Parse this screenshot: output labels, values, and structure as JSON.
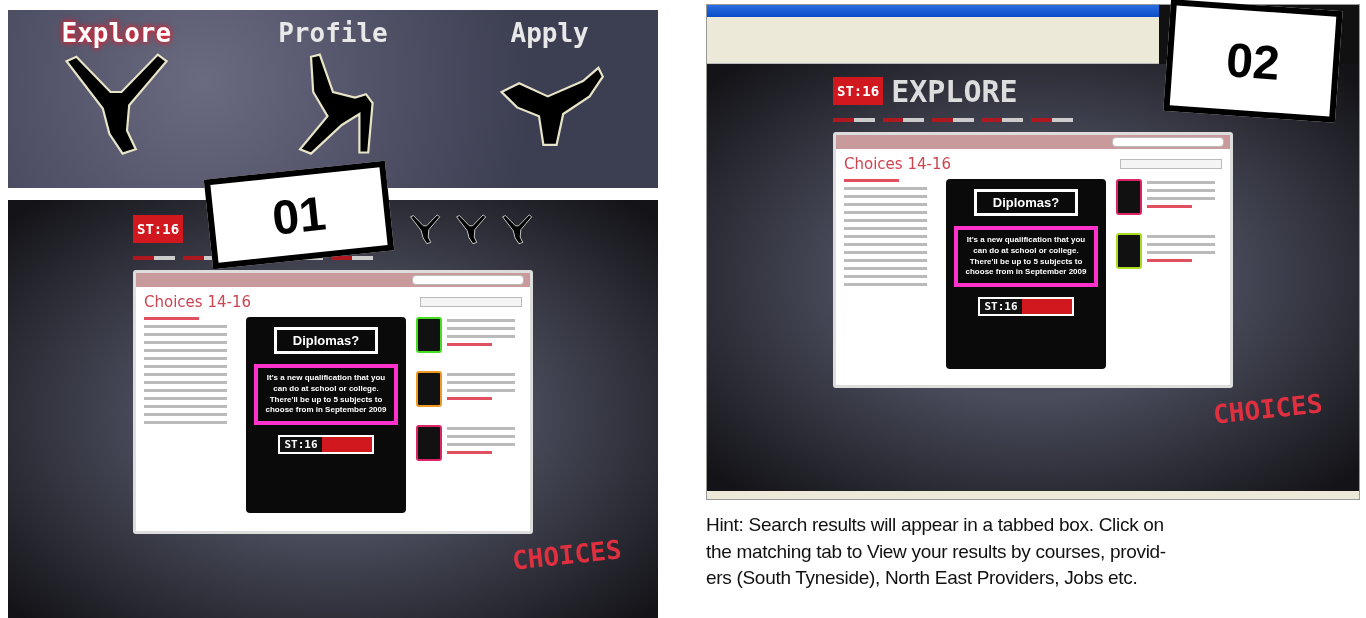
{
  "banner": {
    "items": [
      {
        "label": "Explore",
        "selected": true
      },
      {
        "label": "Profile",
        "selected": false
      },
      {
        "label": "Apply",
        "selected": false
      }
    ]
  },
  "screenshots": [
    {
      "kind": "plain",
      "callout": "01",
      "logo": "ST:16",
      "title": "Choices 14-16",
      "poster": {
        "heading": "Diplomas?",
        "text": "It's a new qualification that you can do at school or college. There'll be up to 5 subjects to choose from in September 2009",
        "logo": "ST:16"
      },
      "items": [
        {
          "color": "#44dd22"
        },
        {
          "color": "#ee9922"
        },
        {
          "color": "#dd2266"
        }
      ],
      "footer": "CHOICES"
    },
    {
      "kind": "browser",
      "callout": "02",
      "logo": "ST:16",
      "heading": "EXPLORE",
      "title": "Choices 14-16",
      "poster": {
        "heading": "Diplomas?",
        "text": "It's a new qualification that you can do at school or college. There'll be up to 5 subjects to choose from in September 2009",
        "logo": "ST:16"
      },
      "items": [
        {
          "color": "#dd2266"
        },
        {
          "color": "#aadd22"
        }
      ],
      "footer": "CHOICES"
    }
  ],
  "hint": {
    "lines": [
      "Hint: Search results will appear in a tabbed box. Click on",
      "the matching tab to View your results by courses, provid-",
      "ers (South Tyneside), North East Providers, Jobs etc."
    ]
  }
}
